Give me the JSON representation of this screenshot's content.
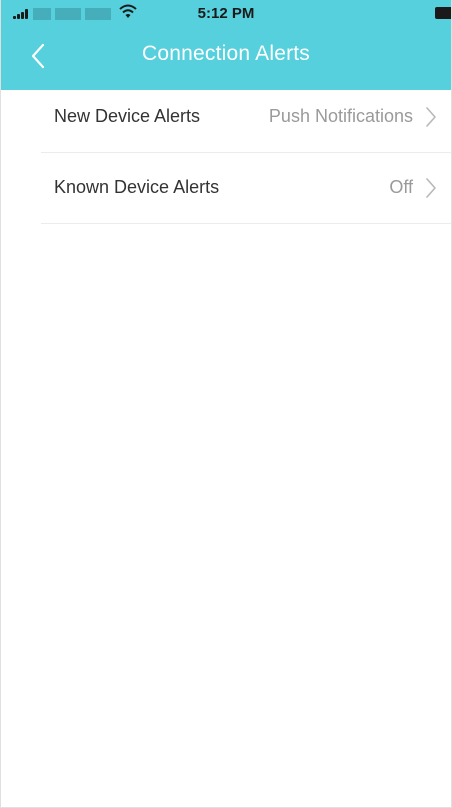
{
  "status_bar": {
    "time": "5:12 PM"
  },
  "nav": {
    "title": "Connection Alerts",
    "back_icon": "chevron-left-icon"
  },
  "colors": {
    "header_bg": "#55d0dc",
    "title_text": "#ffffff",
    "label_text": "#333333",
    "value_text": "#9a9a9a"
  },
  "settings": [
    {
      "label": "New Device Alerts",
      "value": "Push Notifications",
      "icon": "chevron-right-icon"
    },
    {
      "label": "Known Device Alerts",
      "value": "Off",
      "icon": "chevron-right-icon"
    }
  ]
}
